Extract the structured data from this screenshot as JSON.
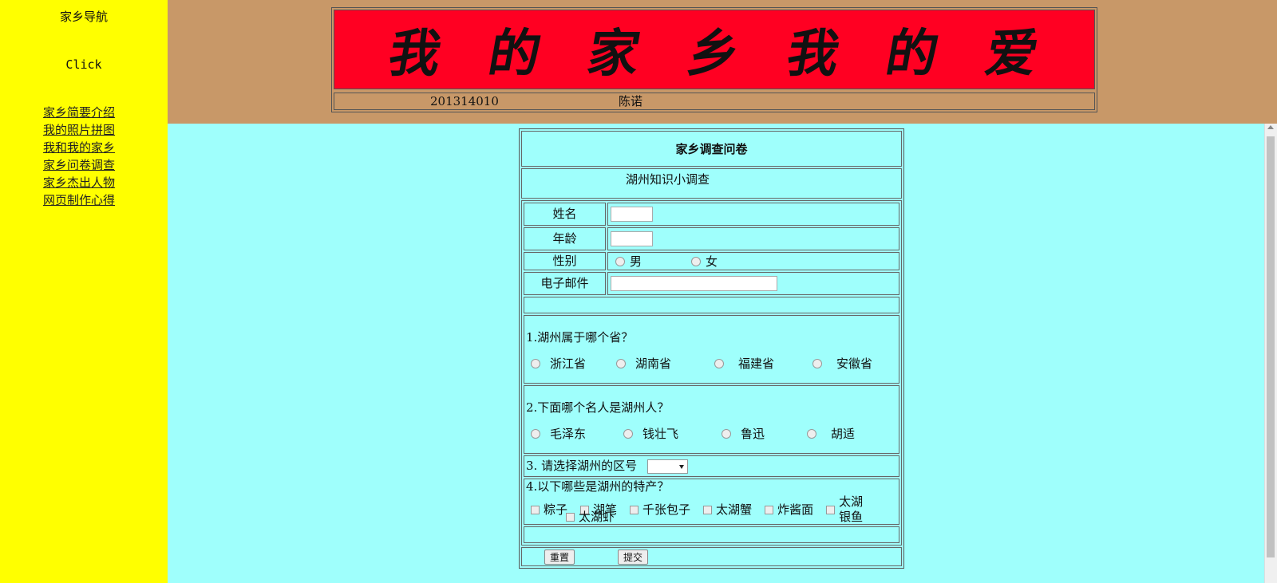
{
  "nav": {
    "title": "家乡导航",
    "click": "Click",
    "links": [
      "家乡简要介绍",
      "我的照片拼图",
      "我和我的家乡",
      "家乡问卷调查",
      "家乡杰出人物",
      "网页制作心得"
    ]
  },
  "banner": {
    "chars": [
      "我",
      "的",
      "家",
      "乡",
      "我",
      "的",
      "爱"
    ],
    "student_id": "201314010",
    "student_name": "陈诺"
  },
  "form": {
    "title": "家乡调查问卷",
    "subtitle": "湖州知识小调查",
    "fields": {
      "name_label": "姓名",
      "age_label": "年龄",
      "gender_label": "性别",
      "gender_options": [
        "男",
        "女"
      ],
      "email_label": "电子邮件"
    },
    "q1": {
      "text": "1.湖州属于哪个省？",
      "options": [
        "浙江省",
        "湖南省",
        "福建省",
        "安徽省"
      ]
    },
    "q2": {
      "text": "2.下面哪个名人是湖州人？",
      "options": [
        "毛泽东",
        "钱壮飞",
        "鲁迅",
        "胡适"
      ]
    },
    "q3": {
      "text": "3. 请选择湖州的区号"
    },
    "q4": {
      "text": "4.以下哪些是湖州的特产？",
      "options": [
        "粽子",
        "湖笔",
        "千张包子",
        "太湖蟹",
        "炸酱面",
        "太湖银鱼",
        "太湖虾"
      ]
    },
    "buttons": {
      "reset": "重置",
      "submit": "提交"
    }
  },
  "colors": {
    "nav_bg": "#ffff00",
    "top_bg": "#c89868",
    "banner_bg": "#ff0022",
    "main_bg": "#9ffffc"
  }
}
